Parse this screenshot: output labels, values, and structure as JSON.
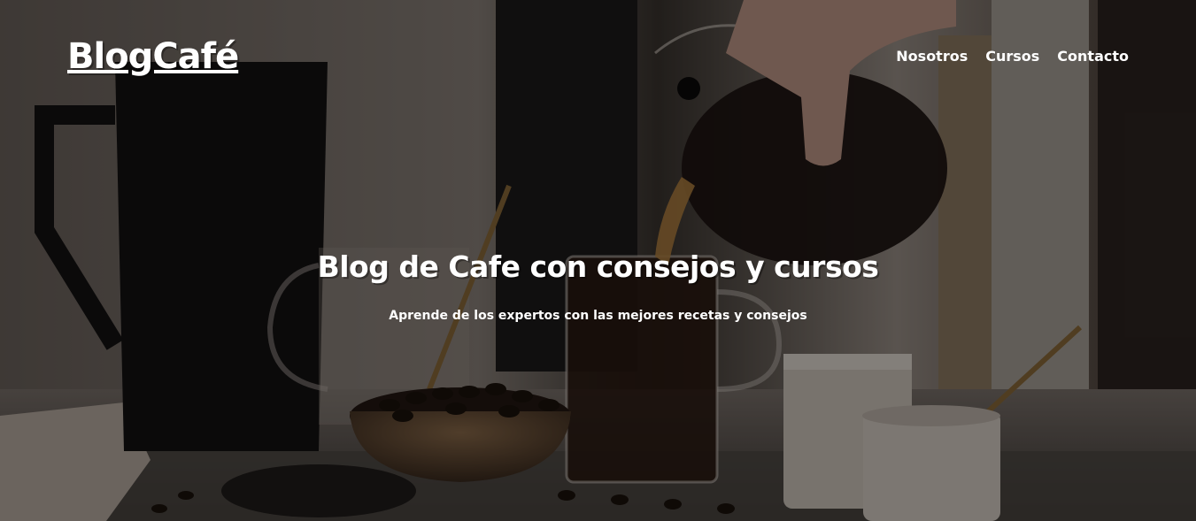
{
  "header": {
    "logo": "BlogCafé",
    "nav": [
      {
        "label": "Nosotros"
      },
      {
        "label": "Cursos"
      },
      {
        "label": "Contacto"
      }
    ]
  },
  "hero": {
    "title": "Blog de Cafe con consejos y cursos",
    "subtitle": "Aprende de los expertos con las mejores recetas y consejos",
    "background_image": "coffee-pouring-photo"
  },
  "colors": {
    "text": "#ffffff",
    "overlay": "#000000"
  }
}
